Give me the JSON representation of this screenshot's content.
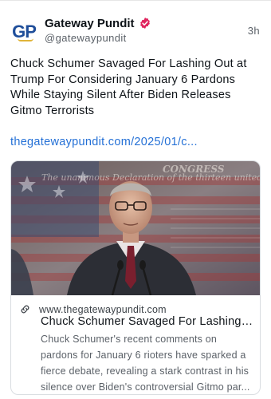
{
  "author": {
    "avatar_text": "GP",
    "name": "Gateway Pundit",
    "handle": "@gatewaypundit",
    "verified_icon": "verified-badge-icon",
    "time": "3h"
  },
  "post": {
    "text": "Chuck Schumer Savaged For Lashing Out at Trump For Considering January 6 Pardons While Staying Silent After Biden Releases Gitmo Terrorists",
    "link": "thegatewaypundit.com/2025/01/c..."
  },
  "card": {
    "image_alt": "Chuck Schumer speaking at a podium",
    "image_text": "The unanimous Declaration of the thirteen united States of America",
    "image_heading": "CONGRESS",
    "link_icon": "link-icon",
    "domain": "www.thegatewaypundit.com",
    "title": "Chuck Schumer Savaged For Lashing ...",
    "description_lines": [
      "Chuck Schumer's recent comments on",
      "pardons for January 6 rioters have sparked a",
      "fierce debate, revealing a stark contrast in his",
      "silence over Biden's controversial Gitmo par..."
    ]
  },
  "colors": {
    "accent_link": "#2470d6",
    "verified": "#e0245e",
    "brand_blue": "#1f4e9a"
  }
}
